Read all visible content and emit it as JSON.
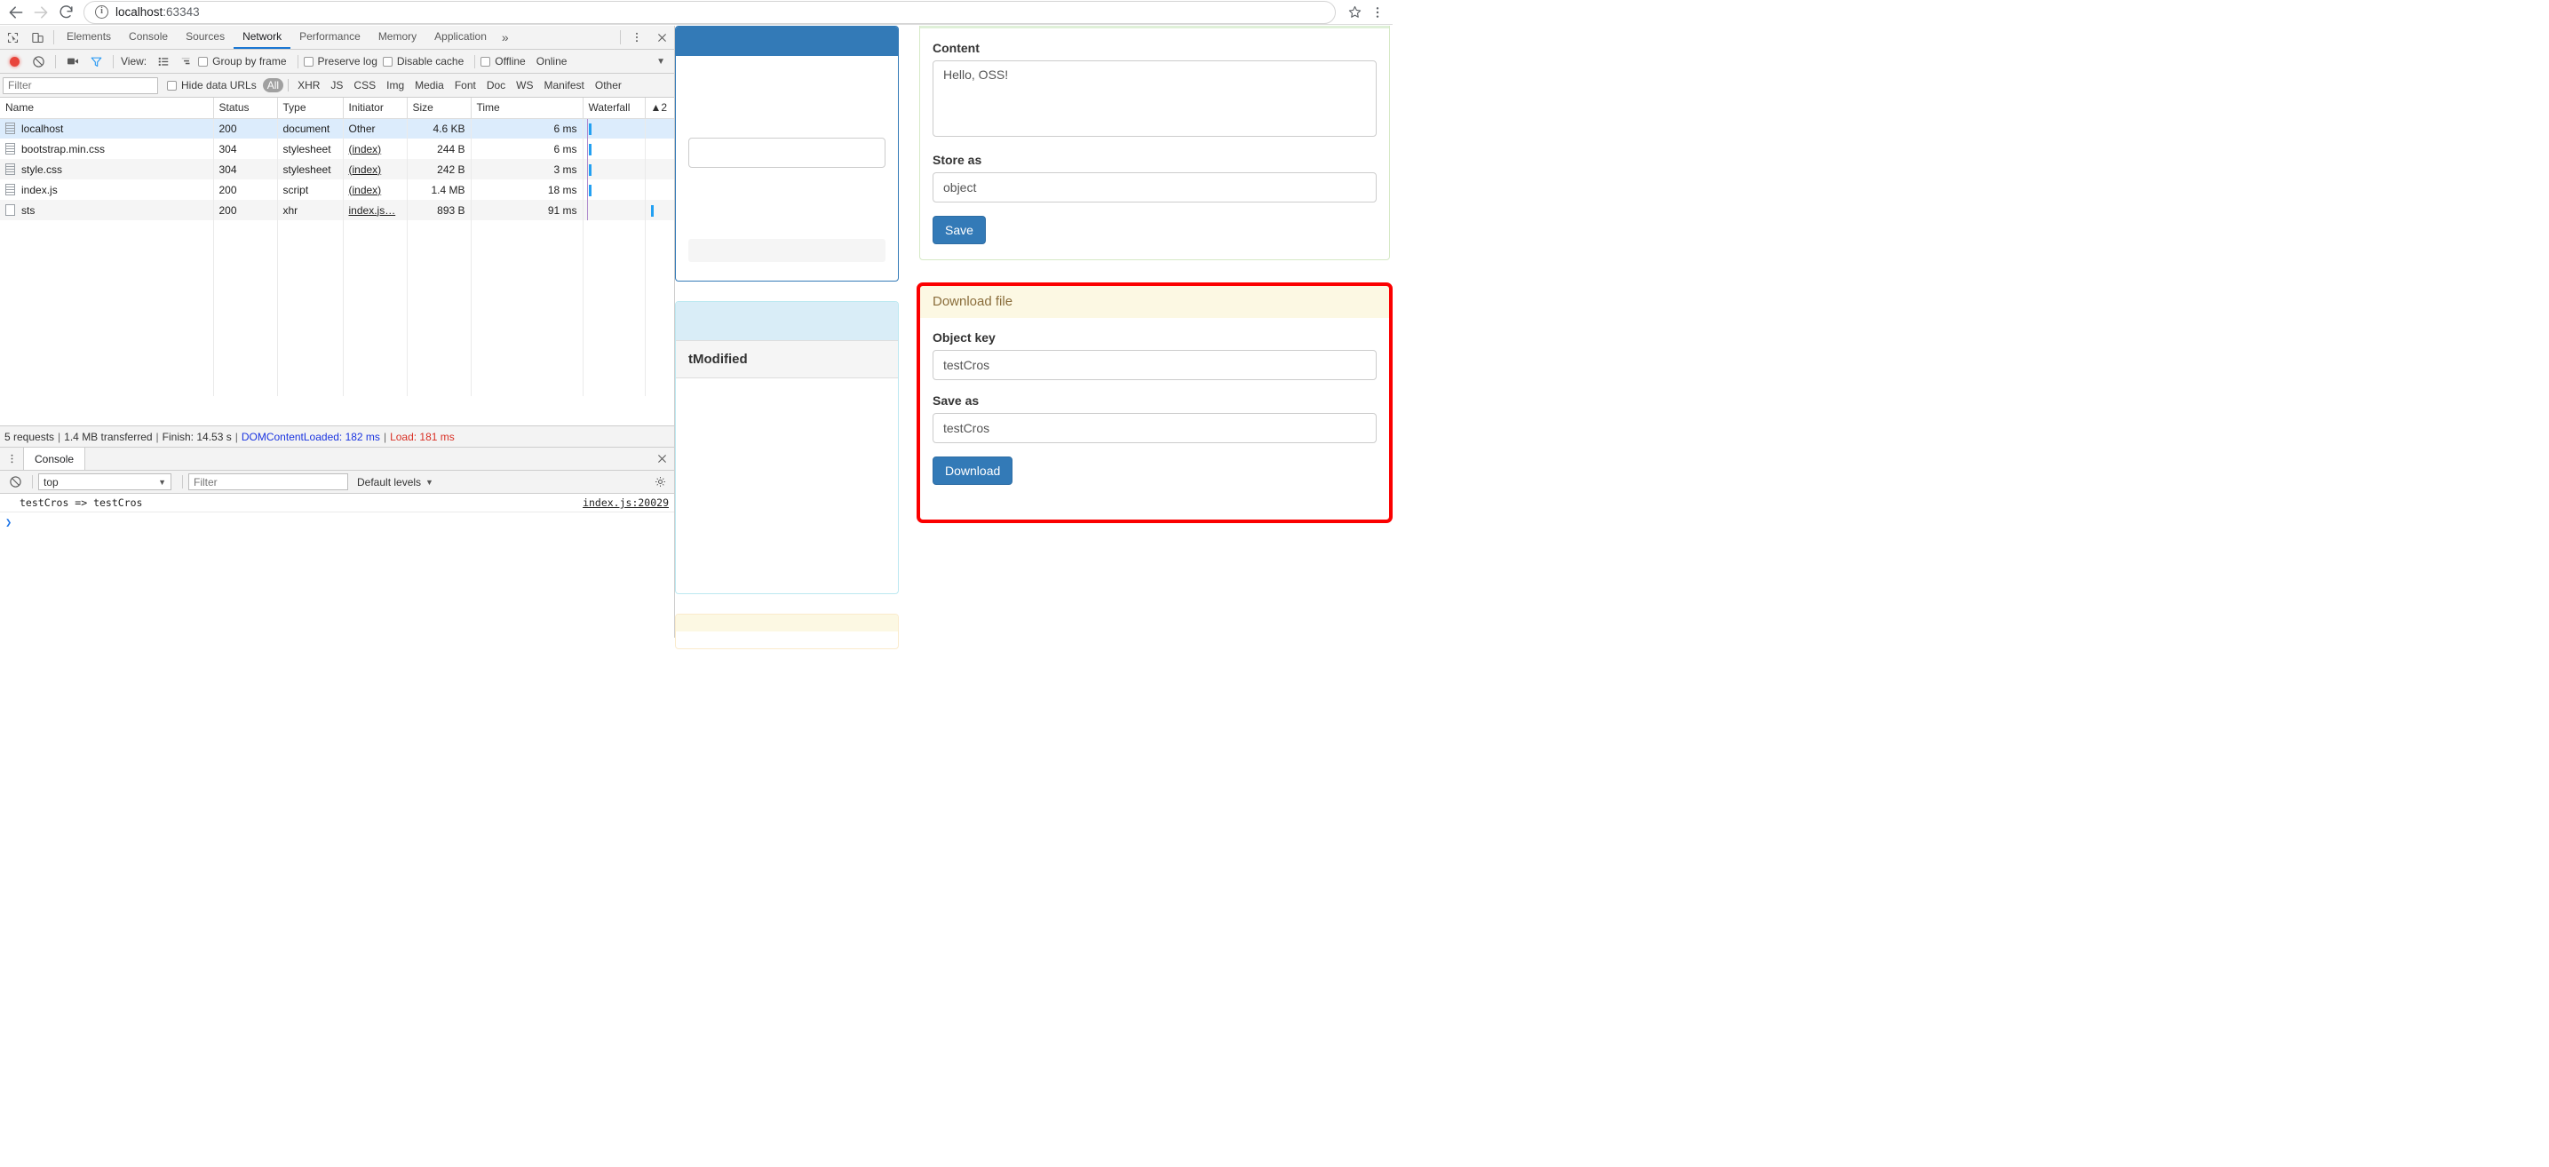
{
  "browser": {
    "back_icon": "arrow-left-icon",
    "forward_icon": "arrow-right-icon",
    "reload_icon": "reload-icon",
    "site_info_icon": "info-icon",
    "url_host": "localhost",
    "url_port": ":63343",
    "bookmark_icon": "star-icon",
    "menu_icon": "kebab-menu-icon"
  },
  "devtools": {
    "inspect_icon": "inspect-element-icon",
    "device_icon": "device-toolbar-icon",
    "tabs": [
      {
        "label": "Elements",
        "active": false
      },
      {
        "label": "Console",
        "active": false
      },
      {
        "label": "Sources",
        "active": false
      },
      {
        "label": "Network",
        "active": true
      },
      {
        "label": "Performance",
        "active": false
      },
      {
        "label": "Memory",
        "active": false
      },
      {
        "label": "Application",
        "active": false
      }
    ],
    "more_tabs_icon": "chevron-double-right-icon",
    "settings_icon": "kebab-menu-icon",
    "close_icon": "close-icon",
    "network_toolbar": {
      "record_icon": "record-button",
      "clear_icon": "clear-icon",
      "capture_screenshots_icon": "camera-icon",
      "filter_icon": "funnel-icon",
      "view_label": "View:",
      "view_list_icon": "list-view-icon",
      "view_waterfall_icon": "waterfall-view-icon",
      "group_by_frame": "Group by frame",
      "preserve_log": "Preserve log",
      "disable_cache": "Disable cache",
      "offline": "Offline",
      "online": "Online",
      "throttle_caret_icon": "chevron-down-icon"
    },
    "filter_bar": {
      "filter_placeholder": "Filter",
      "filter_value": "",
      "hide_data_urls": "Hide data URLs",
      "types": [
        "All",
        "XHR",
        "JS",
        "CSS",
        "Img",
        "Media",
        "Font",
        "Doc",
        "WS",
        "Manifest",
        "Other"
      ],
      "active_type": "All"
    },
    "table": {
      "columns": [
        "Name",
        "Status",
        "Type",
        "Initiator",
        "Size",
        "Time",
        "Waterfall"
      ],
      "sort_marker": "▲2",
      "rows": [
        {
          "name": "localhost",
          "status": "200",
          "type": "document",
          "initiator": "Other",
          "initiator_link": false,
          "size": "4.6 KB",
          "time": "6 ms",
          "selected": true
        },
        {
          "name": "bootstrap.min.css",
          "status": "304",
          "type": "stylesheet",
          "initiator": "(index)",
          "initiator_link": true,
          "size": "244 B",
          "time": "6 ms",
          "selected": false
        },
        {
          "name": "style.css",
          "status": "304",
          "type": "stylesheet",
          "initiator": "(index)",
          "initiator_link": true,
          "size": "242 B",
          "time": "3 ms",
          "selected": false
        },
        {
          "name": "index.js",
          "status": "200",
          "type": "script",
          "initiator": "(index)",
          "initiator_link": true,
          "size": "1.4 MB",
          "time": "18 ms",
          "selected": false
        },
        {
          "name": "sts",
          "status": "200",
          "type": "xhr",
          "initiator": "index.js…",
          "initiator_link": true,
          "size": "893 B",
          "time": "91 ms",
          "selected": false
        }
      ]
    },
    "summary": {
      "requests": "5 requests",
      "transferred": "1.4 MB transferred",
      "finish": "Finish: 14.53 s",
      "dom_content_loaded": "DOMContentLoaded: 182 ms",
      "load": "Load: 181 ms",
      "separator": "|"
    },
    "drawer": {
      "kebab_icon": "kebab-menu-icon",
      "tab_label": "Console",
      "close_icon": "close-icon",
      "clear_icon": "clear-icon",
      "context": "top",
      "context_caret_icon": "chevron-down-icon",
      "filter_placeholder": "Filter",
      "levels": "Default levels",
      "levels_caret_icon": "chevron-down-icon",
      "settings_icon": "gear-icon",
      "messages": [
        {
          "text": "testCros => testCros",
          "source": "index.js:20029"
        }
      ],
      "prompt_icon": "chevron-right-icon"
    }
  },
  "page": {
    "left_column": {
      "panel_blue_stub": "",
      "stub_bar": "",
      "list_header": "tModified"
    },
    "upload_panel": {
      "content_label": "Content",
      "content_value": "Hello, OSS!",
      "store_as_label": "Store as",
      "store_as_value": "object",
      "save_button": "Save"
    },
    "download_panel": {
      "title": "Download file",
      "object_key_label": "Object key",
      "object_key_value": "testCros",
      "save_as_label": "Save as",
      "save_as_value": "testCros",
      "download_button": "Download",
      "highlight_color": "#fb0000"
    }
  }
}
